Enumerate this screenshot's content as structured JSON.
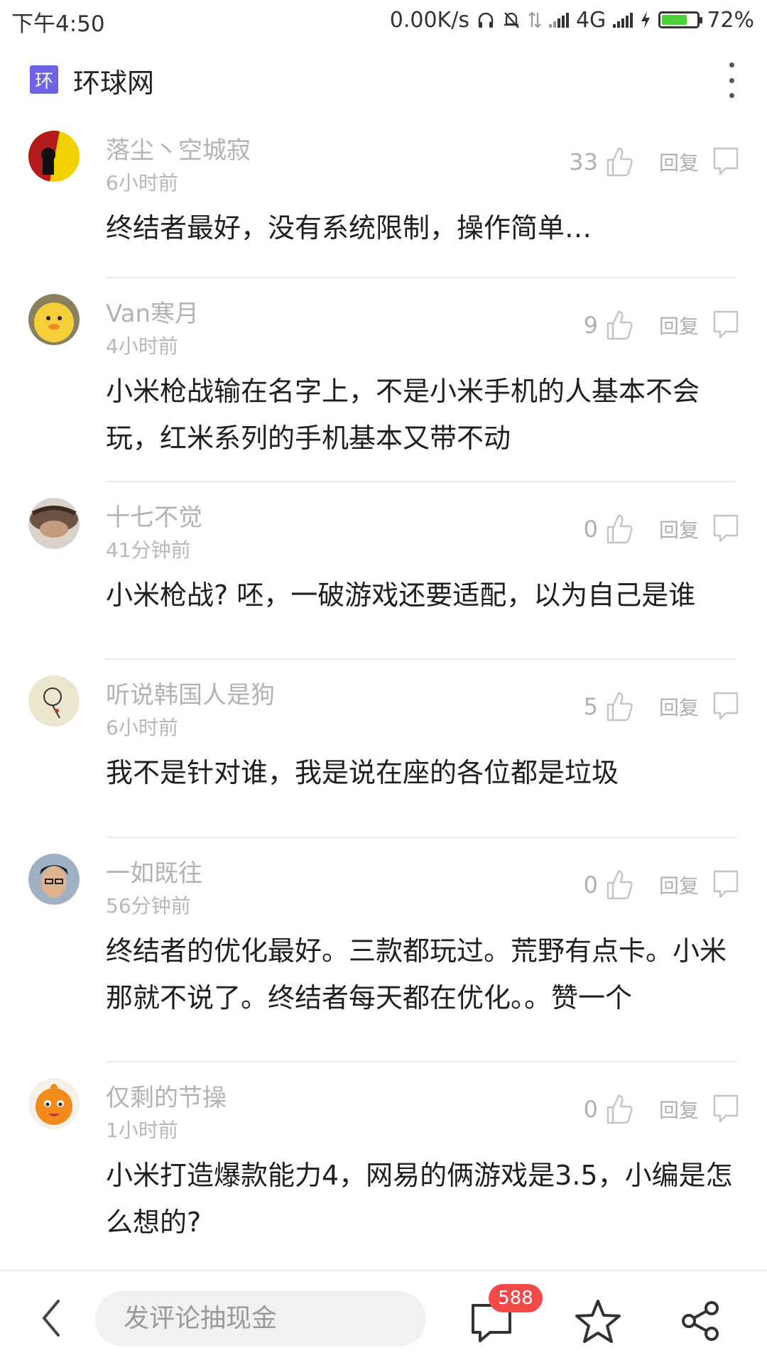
{
  "status_bar": {
    "time": "下午4:50",
    "net_speed": "0.00K/s",
    "network": "4G",
    "battery_percent": "72%",
    "battery_level": 0.72
  },
  "app_bar": {
    "logo_text": "环",
    "title": "环球网",
    "more_icon": "more-vertical-icon"
  },
  "comments": [
    {
      "user": "落尘丶空城寂",
      "time": "6小时前",
      "likes": "33",
      "reply_label": "回复",
      "text": "终结者最好，没有系统限制，操作简单…",
      "avatar_color": "#b41a1a"
    },
    {
      "user": "Van寒月",
      "time": "4小时前",
      "likes": "9",
      "reply_label": "回复",
      "text": "小米枪战输在名字上，不是小米手机的人基本不会玩，红米系列的手机基本又带不动",
      "avatar_color": "#e9c13a"
    },
    {
      "user": "十七不觉",
      "time": "41分钟前",
      "likes": "0",
      "reply_label": "回复",
      "text": "小米枪战? 呸，一破游戏还要适配，以为自己是谁",
      "avatar_color": "#6a5344"
    },
    {
      "user": "听说韩国人是狗",
      "time": "6小时前",
      "likes": "5",
      "reply_label": "回复",
      "text": "我不是针对谁，我是说在座的各位都是垃圾",
      "avatar_color": "#ece6cf"
    },
    {
      "user": "一如既往",
      "time": "56分钟前",
      "likes": "0",
      "reply_label": "回复",
      "text": "终结者的优化最好。三款都玩过。荒野有点卡。小米那就不说了。终结者每天都在优化。。赞一个",
      "avatar_color": "#5a6b80"
    },
    {
      "user": "仅剩的节操",
      "time": "1小时前",
      "likes": "0",
      "reply_label": "回复",
      "text": "小米打造爆款能力4，网易的俩游戏是3.5，小编是怎么想的?",
      "avatar_color": "#f28a1c"
    }
  ],
  "bottom_bar": {
    "input_placeholder": "发评论抽现金",
    "comment_count": "588",
    "back_icon": "back-chevron-icon",
    "comments_icon": "comment-bubble-icon",
    "favorite_icon": "star-icon",
    "share_icon": "share-icon",
    "badge_color": "#f24a47"
  }
}
